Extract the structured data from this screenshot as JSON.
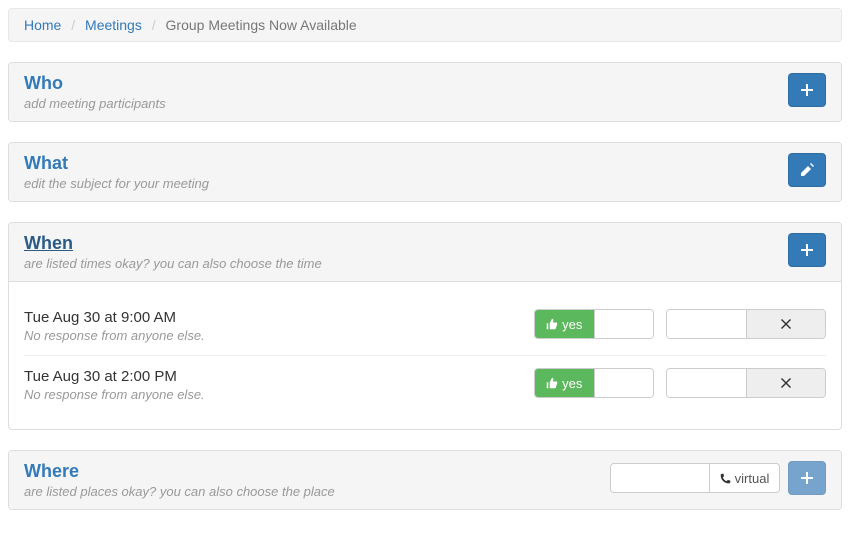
{
  "breadcrumb": {
    "home": "Home",
    "meetings": "Meetings",
    "current": "Group Meetings Now Available"
  },
  "who": {
    "title": "Who",
    "subtitle": "add meeting participants"
  },
  "what": {
    "title": "What",
    "subtitle": "edit the subject for your meeting"
  },
  "when": {
    "title": "When",
    "subtitle": "are listed times okay? you can also choose the time",
    "yes_label": "yes",
    "times": [
      {
        "label": "Tue Aug 30 at 9:00 AM",
        "status": "No response from anyone else."
      },
      {
        "label": "Tue Aug 30 at 2:00 PM",
        "status": "No response from anyone else."
      }
    ]
  },
  "where": {
    "title": "Where",
    "subtitle": "are listed places okay?  you can also choose the place",
    "virtual_label": "virtual"
  }
}
